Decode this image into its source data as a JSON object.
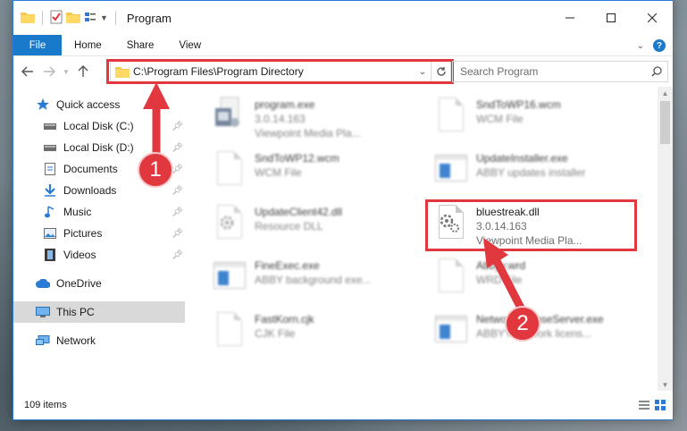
{
  "window": {
    "title": "Program"
  },
  "ribbon": {
    "tabs": [
      "File",
      "Home",
      "Share",
      "View"
    ]
  },
  "address": {
    "path": "C:\\Program Files\\Program Directory"
  },
  "search": {
    "placeholder": "Search Program"
  },
  "sidebar": {
    "items": [
      {
        "label": "Quick access",
        "icon": "star-icon"
      },
      {
        "label": "Local Disk (C:)",
        "icon": "drive-icon"
      },
      {
        "label": "Local Disk (D:)",
        "icon": "drive-icon"
      },
      {
        "label": "Documents",
        "icon": "documents-icon"
      },
      {
        "label": "Downloads",
        "icon": "download-icon"
      },
      {
        "label": "Music",
        "icon": "music-icon"
      },
      {
        "label": "Pictures",
        "icon": "pictures-icon"
      },
      {
        "label": "Videos",
        "icon": "videos-icon"
      },
      {
        "label": "OneDrive",
        "icon": "cloud-icon"
      },
      {
        "label": "This PC",
        "icon": "computer-icon"
      },
      {
        "label": "Network",
        "icon": "network-icon"
      }
    ]
  },
  "files": [
    {
      "name": "program.exe",
      "line2": "3.0.14.163",
      "line3": "Viewpoint Media Pla..."
    },
    {
      "name": "SndToWP16.wcm",
      "line2": "WCM File",
      "line3": ""
    },
    {
      "name": "SndToWP12.wcm",
      "line2": "WCM File",
      "line3": ""
    },
    {
      "name": "UpdateInstaller.exe",
      "line2": "ABBY updates installer",
      "line3": ""
    },
    {
      "name": "UpdateClient42.dll",
      "line2": "Resource DLL",
      "line3": ""
    },
    {
      "name": "bluestreak.dll",
      "line2": "3.0.14.163",
      "line3": "Viewpoint Media Pla..."
    },
    {
      "name": "FineExec.exe",
      "line2": "ABBY background exe...",
      "line3": ""
    },
    {
      "name": "Abbyy.wrd",
      "line2": "WRD File",
      "line3": ""
    },
    {
      "name": "FastKorn.cjk",
      "line2": "CJK File",
      "line3": ""
    },
    {
      "name": "NetworkLicenseServer.exe",
      "line2": "ABBYY network licens...",
      "line3": ""
    }
  ],
  "status": {
    "item_count": "109 items"
  },
  "annotations": {
    "step1": "1",
    "step2": "2"
  },
  "colors": {
    "accent": "#1979ca",
    "highlight": "#e0383e",
    "selection": "#cce8ff"
  }
}
